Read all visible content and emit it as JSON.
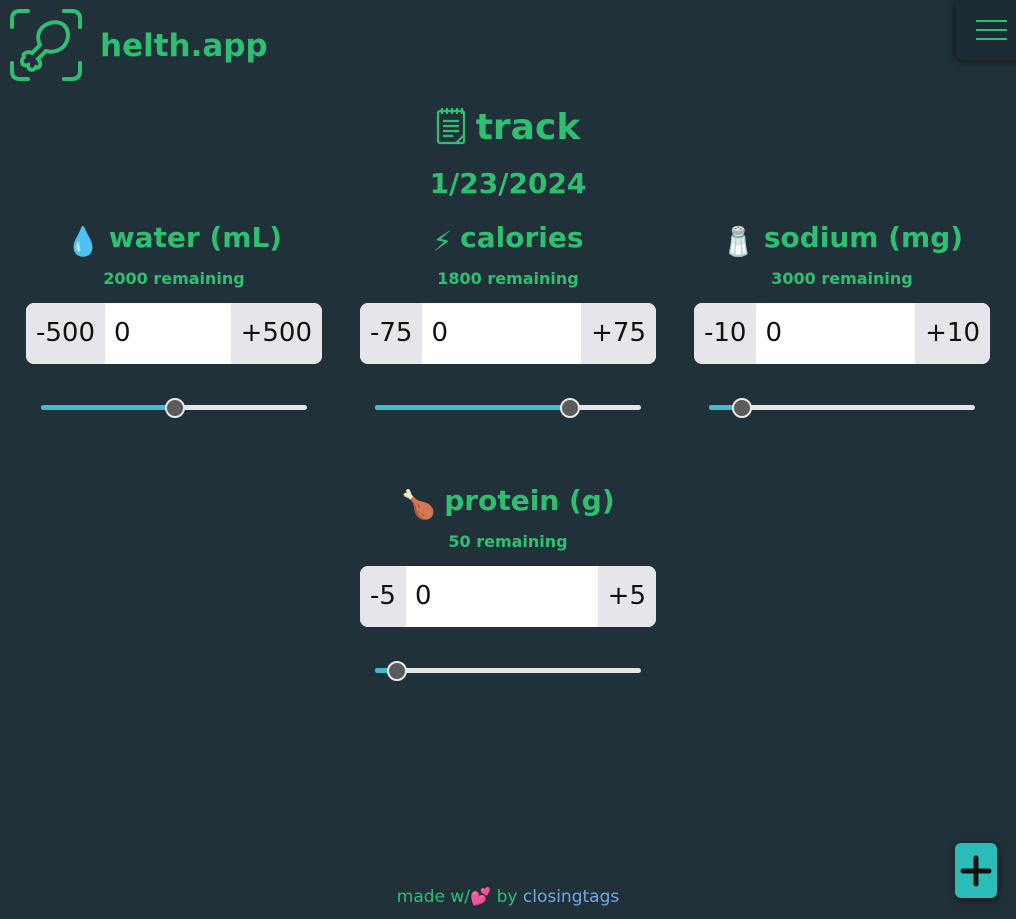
{
  "brand": {
    "name": "helth.app"
  },
  "menu": {
    "icon": "hamburger-icon"
  },
  "page": {
    "icon": "notepad-icon",
    "title": "track",
    "date": "1/23/2024"
  },
  "trackers": [
    {
      "emoji": "💧",
      "label": "water (mL)",
      "remaining": "2000 remaining",
      "decrement": "-500",
      "value": "0",
      "increment": "+500",
      "slider_level": 0.5
    },
    {
      "emoji": "⚡",
      "label": "calories",
      "remaining": "1800 remaining",
      "decrement": "-75",
      "value": "0",
      "increment": "+75",
      "slider_level": 0.73
    },
    {
      "emoji": "🧂",
      "label": "sodium (mg)",
      "remaining": "3000 remaining",
      "decrement": "-10",
      "value": "0",
      "increment": "+10",
      "slider_level": 0.12
    },
    {
      "emoji": "🍗",
      "label": "protein (g)",
      "remaining": "50 remaining",
      "decrement": "-5",
      "value": "0",
      "increment": "+5",
      "slider_level": 0.08
    }
  ],
  "footer": {
    "prefix": "made w/",
    "heart": "💕",
    "by": " by ",
    "link": "closingtags"
  },
  "fab": {
    "icon": "plus-icon"
  },
  "colors": {
    "background": "#21313a",
    "accent": "#2fbf71",
    "slider_fill": "#3fbccc",
    "fab": "#2bbcb7",
    "link": "#6ea9e6"
  }
}
